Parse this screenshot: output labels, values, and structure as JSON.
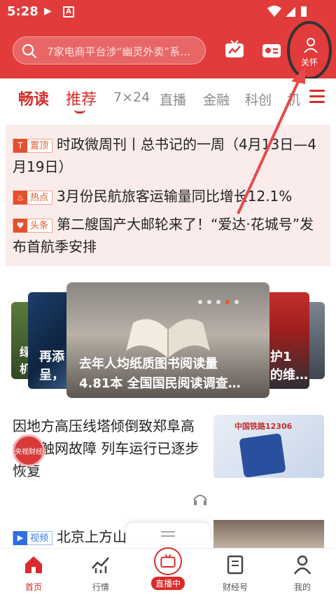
{
  "status": {
    "time": "5:28",
    "app_icon": "A"
  },
  "header": {
    "search_placeholder": "7家电商平台涉“幽灵外卖”系…",
    "care_label": "关怀"
  },
  "tabs": {
    "logo": "畅读",
    "items": [
      "推荐",
      "7×24",
      "直播",
      "金融",
      "科创",
      "机"
    ]
  },
  "top_news": [
    {
      "badge": "置顶",
      "badge_icon": "pin-icon",
      "text": "时政微周刊丨总书记的一周（4月13日—4月19日）"
    },
    {
      "badge": "热点",
      "badge_icon": "fire-icon",
      "text": "3月份民航旅客运输量同比增长12.1%"
    },
    {
      "badge": "头条",
      "badge_icon": "heart-icon",
      "text": "第二艘国产大邮轮来了！“爱达·花城号”发布首航季安排"
    }
  ],
  "carousel": {
    "main_caption_1": "去年人均纸质图书阅读量",
    "main_caption_2": "4.81本 全国国民阅读调查…",
    "left_caption_1": "再添",
    "left_caption_2": "呈，",
    "left_caption_3": "绿",
    "left_caption_4": "机",
    "right_caption_1": "护1",
    "right_caption_2": "的维…"
  },
  "article": {
    "title": "因地方高压线塔倾倒致郑阜高铁接触网故障 列车运行已逐步恢复",
    "float_badge": "央视财经",
    "thumb_text": "中国铁路12306"
  },
  "video_item": {
    "badge": "视频",
    "text": "北京上方山森林公园"
  },
  "bottom_nav": [
    {
      "label": "首页",
      "icon": "home-icon"
    },
    {
      "label": "行情",
      "icon": "chart-icon"
    },
    {
      "label": "直播中",
      "icon": "tv-icon"
    },
    {
      "label": "财经号",
      "icon": "doc-icon"
    },
    {
      "label": "我的",
      "icon": "user-icon"
    }
  ],
  "colors": {
    "brand_red": "#e23b3b",
    "accent_red": "#d92b2b"
  }
}
